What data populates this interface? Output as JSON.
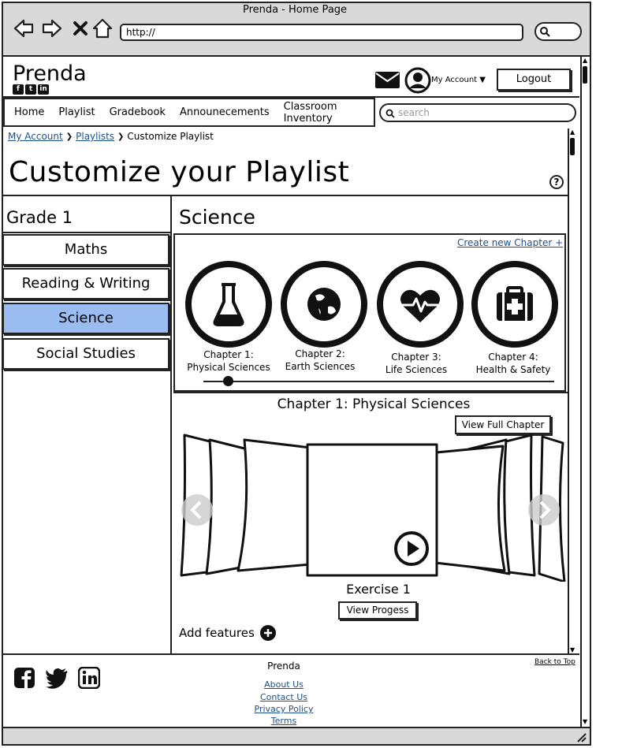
{
  "browser": {
    "title": "Prenda - Home Page",
    "url": "http://"
  },
  "header": {
    "brand": "Prenda",
    "account_label": "My Account",
    "logout_label": "Logout"
  },
  "nav": {
    "items": [
      {
        "label": "Home"
      },
      {
        "label": "Playlist"
      },
      {
        "label": "Gradebook"
      },
      {
        "label": "Announecements"
      },
      {
        "label": "Classroom Inventory"
      }
    ],
    "search_placeholder": "search"
  },
  "breadcrumb": {
    "items": [
      {
        "label": "My Account"
      },
      {
        "label": "Playlists"
      },
      {
        "label": "Customize Playlist"
      }
    ]
  },
  "page": {
    "title": "Customize your Playlist",
    "help": "?"
  },
  "sidebar": {
    "grade": "Grade 1",
    "subjects": [
      {
        "label": "Maths",
        "active": false
      },
      {
        "label": "Reading & Writing",
        "active": false
      },
      {
        "label": "Science",
        "active": true
      },
      {
        "label": "Social Studies",
        "active": false
      }
    ]
  },
  "main": {
    "subject_title": "Science",
    "create_chapter_label": "Create new Chapter +",
    "chapters": [
      {
        "line1": "Chapter 1:",
        "line2": "Physical Sciences",
        "icon": "flask-icon"
      },
      {
        "line1": "Chapter 2:",
        "line2": "Earth Sciences",
        "icon": "globe-icon"
      },
      {
        "line1": "Chapter 3:",
        "line2": "Life Sciences",
        "icon": "heartbeat-icon"
      },
      {
        "line1": "Chapter 4:",
        "line2": "Health & Safety",
        "icon": "medkit-icon"
      }
    ],
    "selected_chapter_title": "Chapter 1: Physical Sciences",
    "view_full_label": "View Full Chapter",
    "exercise_label": "Exercise 1",
    "view_progress_label": "View Progess",
    "add_features_label": "Add features"
  },
  "footer": {
    "brand": "Prenda",
    "links": [
      {
        "label": "About Us"
      },
      {
        "label": "Contact Us"
      },
      {
        "label": "Privacy Policy"
      },
      {
        "label": "Terms"
      }
    ],
    "back_to_top": "Back to Top"
  },
  "colors": {
    "active_subject": "#9bbcf0",
    "link": "#1f4f8a",
    "chrome": "#d9d9d9"
  }
}
